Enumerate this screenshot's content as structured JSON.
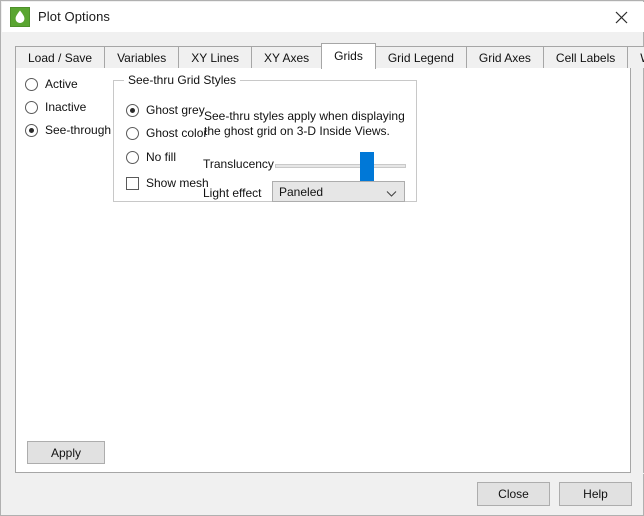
{
  "window": {
    "title": "Plot Options",
    "icon": "app-droplet-icon",
    "close_icon": "close-icon",
    "accent_color": "#0078d7",
    "icon_color": "#5aa531"
  },
  "tabs": [
    {
      "label": "Load / Save",
      "selected": false
    },
    {
      "label": "Variables",
      "selected": false
    },
    {
      "label": "XY Lines",
      "selected": false
    },
    {
      "label": "XY Axes",
      "selected": false
    },
    {
      "label": "Grids",
      "selected": true
    },
    {
      "label": "Grid Legend",
      "selected": false
    },
    {
      "label": "Grid Axes",
      "selected": false
    },
    {
      "label": "Cell Labels",
      "selected": false
    },
    {
      "label": "Wells",
      "selected": false
    }
  ],
  "grid_state": {
    "options": [
      {
        "label": "Active",
        "checked": false
      },
      {
        "label": "Inactive",
        "checked": false
      },
      {
        "label": "See-through",
        "checked": true
      }
    ]
  },
  "see_thru_group": {
    "title": "See-thru Grid Styles",
    "styles": [
      {
        "label": "Ghost grey",
        "checked": true
      },
      {
        "label": "Ghost color",
        "checked": false
      },
      {
        "label": "No fill",
        "checked": false
      }
    ],
    "show_mesh": {
      "label": "Show mesh",
      "checked": false
    },
    "description": "See-thru styles apply when displaying the ghost grid on 3-D Inside Views.",
    "translucency": {
      "label": "Translucency",
      "value": 70,
      "min": 0,
      "max": 100
    },
    "light_effect": {
      "label": "Light effect",
      "value": "Paneled",
      "arrow_icon": "chevron-down-icon"
    }
  },
  "buttons": {
    "apply": "Apply",
    "close": "Close",
    "help": "Help"
  }
}
